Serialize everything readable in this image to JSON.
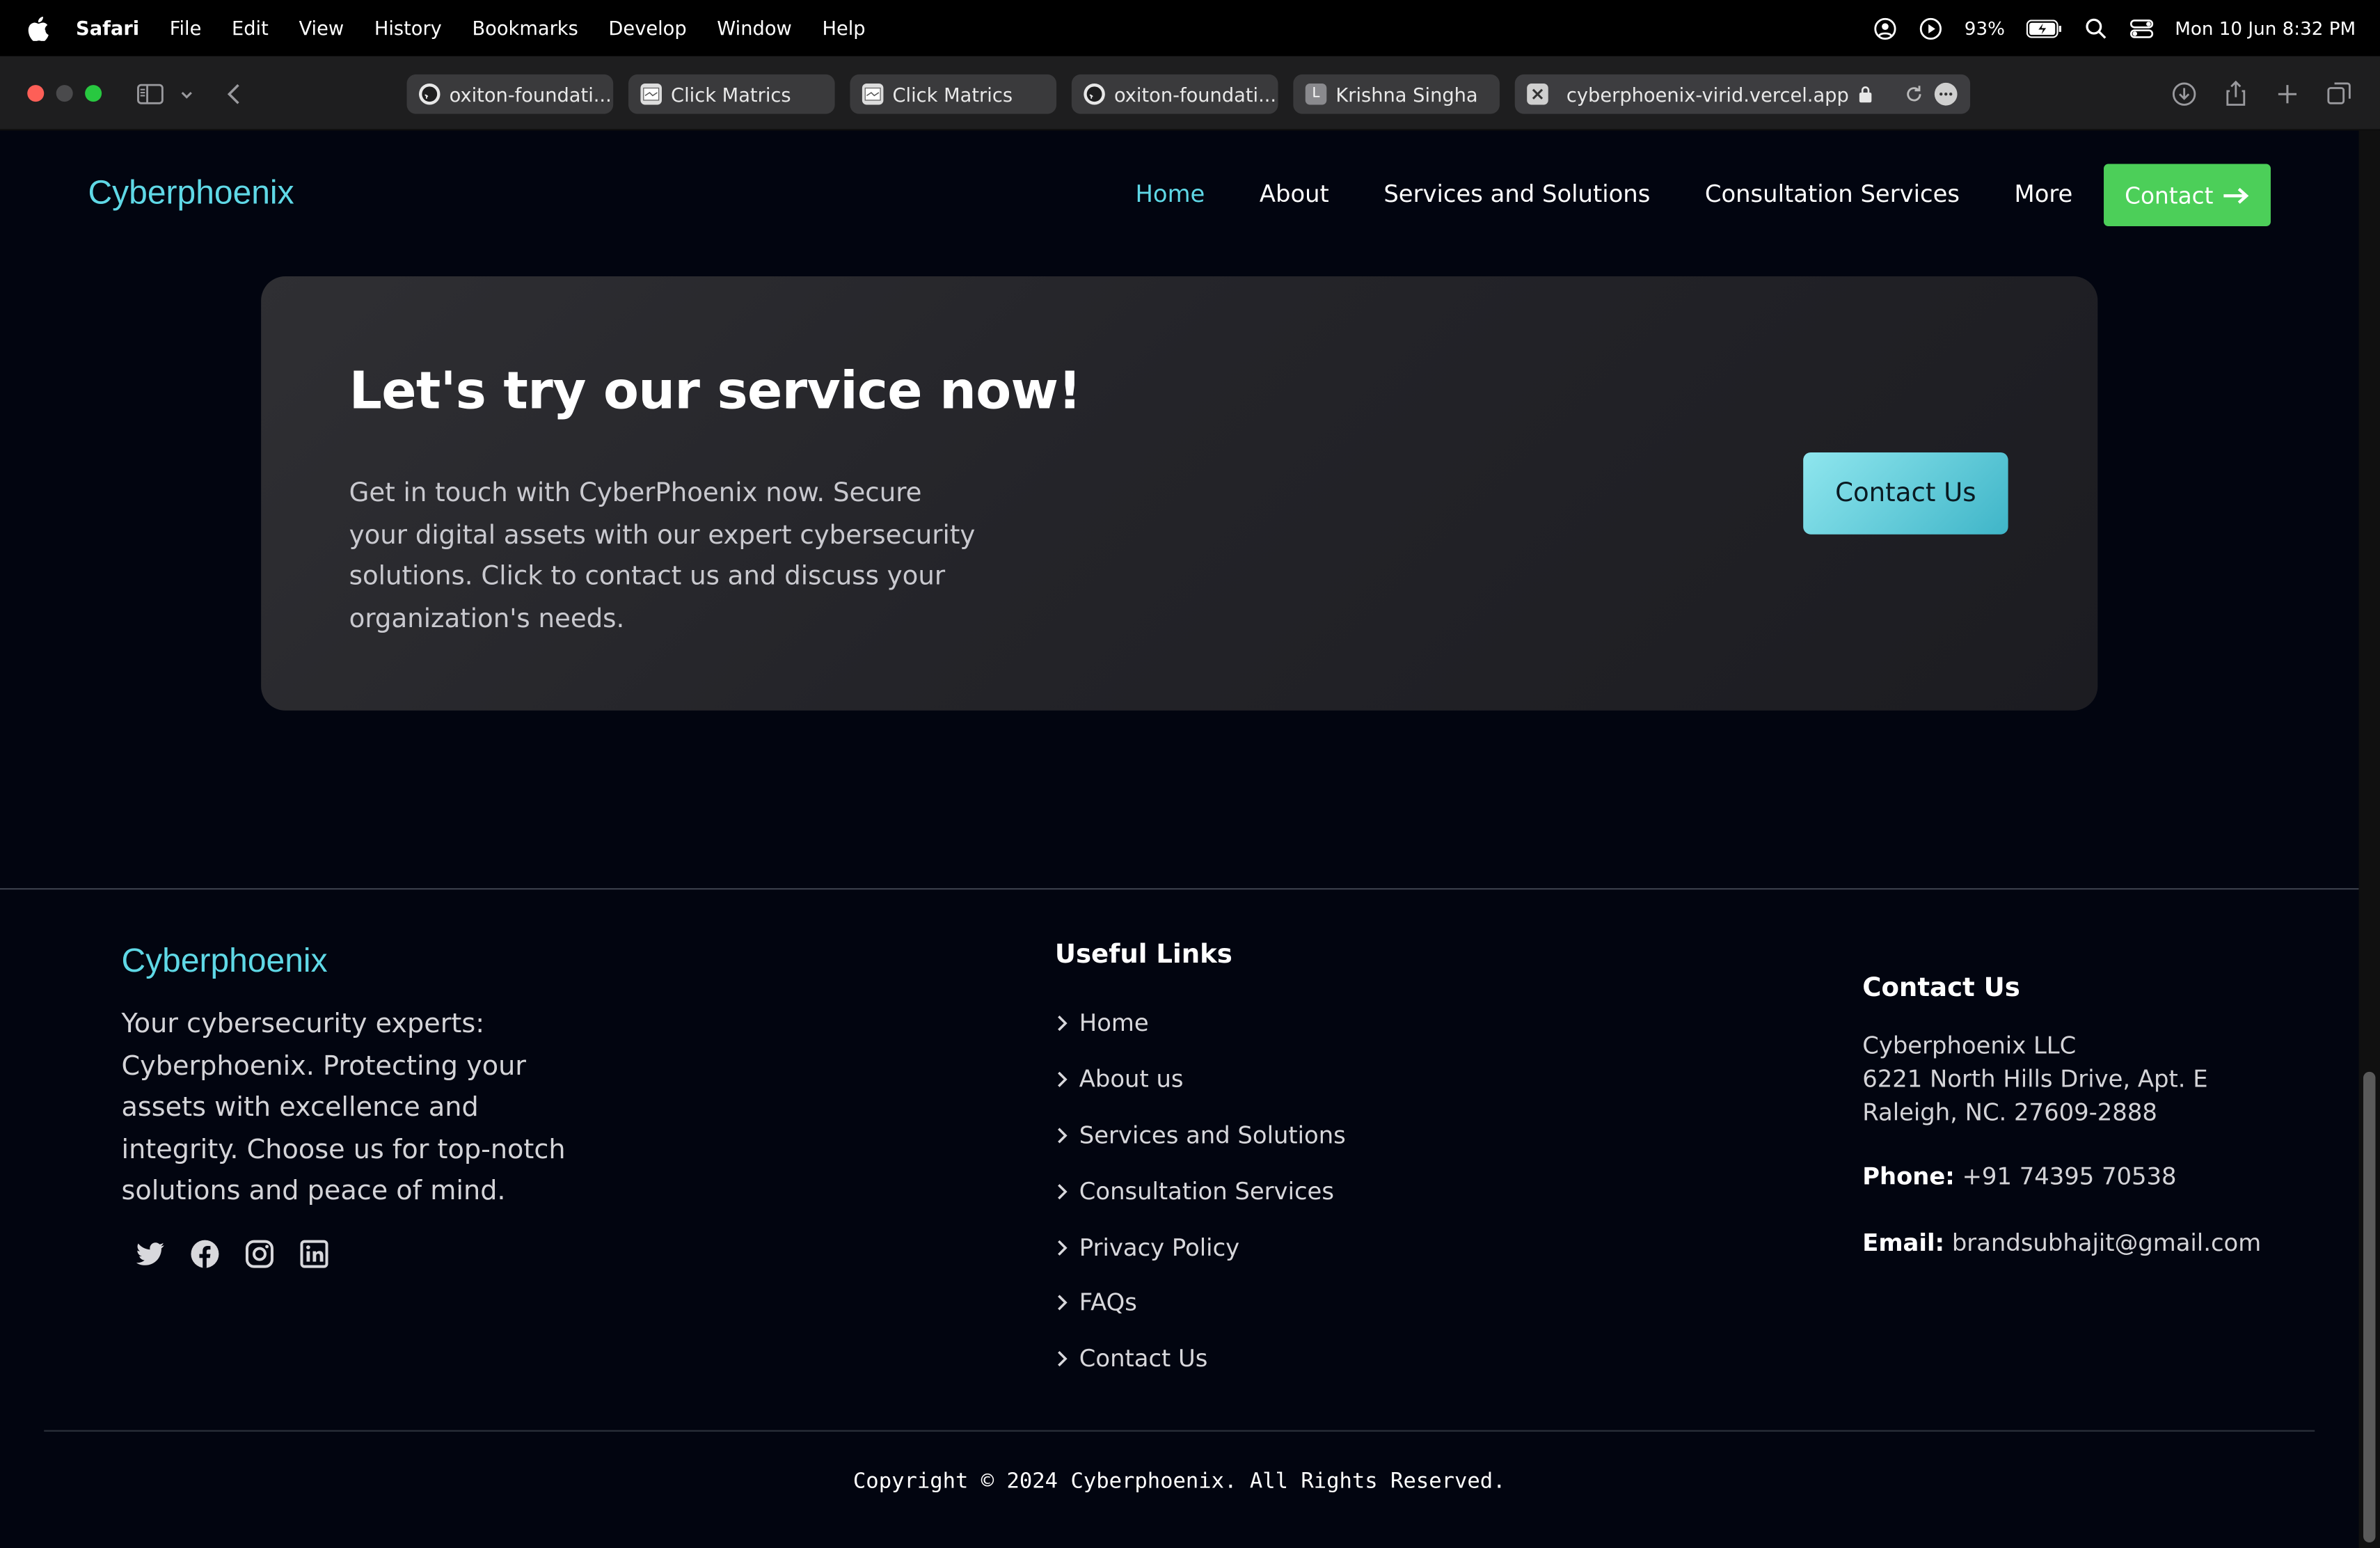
{
  "menubar": {
    "app": "Safari",
    "items": [
      "File",
      "Edit",
      "View",
      "History",
      "Bookmarks",
      "Develop",
      "Window",
      "Help"
    ],
    "battery": "93%",
    "datetime": "Mon 10 Jun  8:32 PM"
  },
  "tabs": [
    {
      "title": "oxiton-foundati...",
      "icon": "github-icon"
    },
    {
      "title": "Click Matrics",
      "icon": "page-icon"
    },
    {
      "title": "Click Matrics",
      "icon": "page-icon"
    },
    {
      "title": "oxiton-foundati...",
      "icon": "github-icon"
    },
    {
      "title": "Krishna Singha",
      "icon": "letter-l-icon"
    },
    {
      "title": "cyberphoenix-virid.vercel.app",
      "icon": "close-icon"
    }
  ],
  "site": {
    "logo": "Cyberphoenix",
    "nav": {
      "home": "Home",
      "about": "About",
      "services": "Services and Solutions",
      "consultation": "Consultation Services",
      "more": "More",
      "contact": "Contact"
    },
    "cta": {
      "title": "Let's try our service now!",
      "text": "Get in touch with CyberPhoenix now. Secure your digital assets with our expert cybersecurity solutions. Click to contact us and discuss your organization's needs.",
      "button": "Contact Us"
    },
    "footer": {
      "logo": "Cyberphoenix",
      "about": "Your cybersecurity experts: Cyberphoenix. Protecting your assets with excellence and integrity. Choose us for top-notch solutions and peace of mind.",
      "links_title": "Useful Links",
      "links": [
        "Home",
        "About us",
        "Services and Solutions",
        "Consultation Services",
        "Privacy Policy",
        "FAQs",
        "Contact Us"
      ],
      "contact_title": "Contact Us",
      "address_line1": "Cyberphoenix LLC",
      "address_line2": "6221 North Hills Drive, Apt. E",
      "address_line3": "Raleigh, NC. 27609-2888",
      "phone_label": "Phone:",
      "phone": "+91 74395 70538",
      "email_label": "Email:",
      "email": "brandsubhajit@gmail.com",
      "copyright": "Copyright © 2024 Cyberphoenix. All Rights Reserved."
    }
  }
}
